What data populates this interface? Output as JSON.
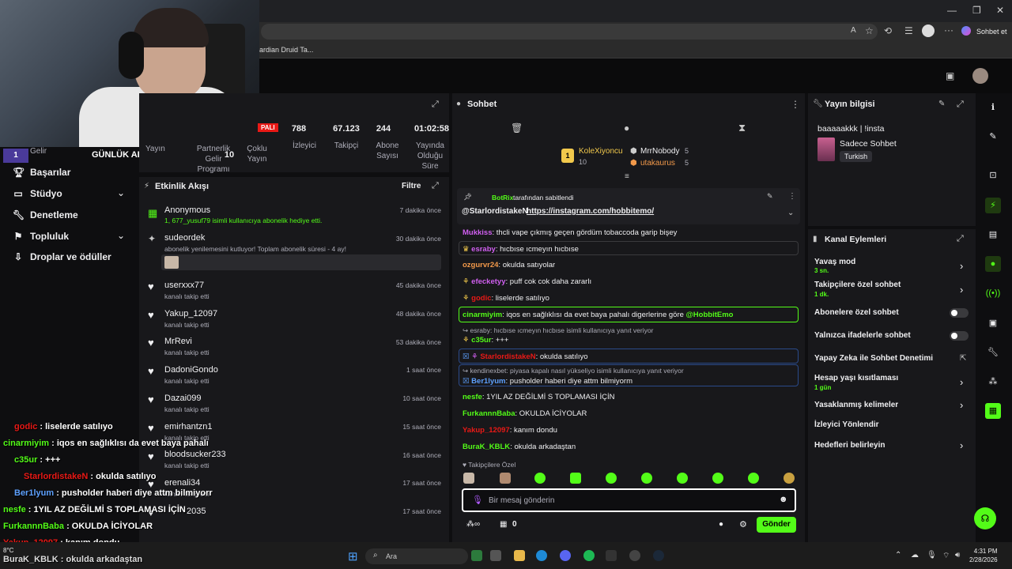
{
  "browser": {
    "bookmark": "ardian Druid Ta...",
    "chat_button": "Sohbet et"
  },
  "sidebar": {
    "header_rank": "1",
    "header_text": "Gelir",
    "daily_sub_label": "GÜNLÜK ABONE",
    "items": [
      {
        "label": "Başarılar",
        "icon": "trophy-icon"
      },
      {
        "label": "Stüdyo",
        "icon": "studio-icon",
        "chevron": true
      },
      {
        "label": "Denetleme",
        "icon": "wrench-icon"
      },
      {
        "label": "Topluluk",
        "icon": "community-icon",
        "chevron": true
      },
      {
        "label": "Droplar ve ödüller",
        "icon": "drops-icon"
      }
    ]
  },
  "stats": {
    "left_labels": [
      "Yayın",
      "Partnerlik Gelir Programı",
      "Çoklu Yayın"
    ],
    "partner_value": "10",
    "badge": "PALI",
    "items": [
      {
        "value": "788",
        "label": "İzleyici"
      },
      {
        "value": "67.123",
        "label": "Takipçi"
      },
      {
        "value": "244",
        "label": "Abone Sayısı"
      },
      {
        "value": "01:02:58",
        "label": "Yayında Olduğu Süre"
      }
    ]
  },
  "feed": {
    "title": "Etkinlik Akışı",
    "filter": "Filtre",
    "rows": [
      {
        "name": "Anonymous",
        "sub": "1, 677_yusuf79 isimli kullanıcıya abonelik hediye etti.",
        "time": "7 dakika önce"
      },
      {
        "name": "sudeordek",
        "sub": "abonelik yenilemesini kutluyor! Toplam abonelik süresi - 4 ay!",
        "time": "30 dakika önce"
      },
      {
        "name": "userxxx77",
        "sub": "kanalı takip etti",
        "time": "45 dakika önce"
      },
      {
        "name": "Yakup_12097",
        "sub": "kanalı takip etti",
        "time": "48 dakika önce"
      },
      {
        "name": "MrRevi",
        "sub": "kanalı takip etti",
        "time": "53 dakika önce"
      },
      {
        "name": "DadoniGondo",
        "sub": "kanalı takip etti",
        "time": "1 saat önce"
      },
      {
        "name": "Dazai099",
        "sub": "kanalı takip etti",
        "time": "10 saat önce"
      },
      {
        "name": "emirhantzn1",
        "sub": "kanalı takip etti",
        "time": "15 saat önce"
      },
      {
        "name": "bloodsucker233",
        "sub": "kanalı takip etti",
        "time": "16 saat önce"
      },
      {
        "name": "erenali34",
        "sub": "kanalı takip etti",
        "time": "17 saat önce"
      },
      {
        "name": "2035",
        "sub": "",
        "time": "17 saat önce"
      }
    ]
  },
  "overlay_chat": [
    {
      "user": "godic",
      "text": "liselerde satılıyo",
      "color": "#e91916"
    },
    {
      "user": "cinarmiyim",
      "text": "iqos en sağlıklısı da evet baya pahalı",
      "color": "#53fc18"
    },
    {
      "user": "c35ur",
      "text": "+++",
      "color": "#53fc18"
    },
    {
      "user": "StarlordistakeN",
      "text": "okulda satılıyo",
      "color": "#e91916"
    },
    {
      "user": "Ber1lyum",
      "text": "pusholder haberi diye attm bilmiyorr",
      "color": "#5ea1ff"
    },
    {
      "user": "nesfe",
      "text": "1YIL AZ DEĞİLMİ S TOPLAMASI İÇİN",
      "color": "#53fc18"
    },
    {
      "user": "FurkannnBaba",
      "text": "OKULDA İCİYOLAR",
      "color": "#53fc18"
    },
    {
      "user": "Yakup_12097",
      "text": "kanım dondu",
      "color": "#e91916"
    },
    {
      "user": "BuraK_KBLK",
      "text": "okulda arkadaştan",
      "color": "#ffffff"
    }
  ],
  "chat": {
    "title": "Sohbet",
    "leaders": [
      {
        "name": "KoleXiyoncu",
        "count": "10",
        "color": "#f2c94c"
      },
      {
        "name": "MrrNobody",
        "count": "5",
        "color": "#efeff1"
      },
      {
        "name": "utakaurus",
        "count": "5",
        "color": "#f2994a"
      }
    ],
    "pinned_by": "BotRix",
    "pinned_label": "tarafından sabitlendi",
    "pinned_text": "@StarlordistakeN",
    "pinned_link": "https://instagram.com/hobbitemo/",
    "messages": [
      {
        "user": "Mukkiss",
        "text": "thcli vape çıkmış geçen gördüm tobaccoda garip bişey",
        "color": "#d05ff0"
      },
      {
        "user": "esraby",
        "text": "hıcbıse ıcmeyın hıcbıse",
        "color": "#d05ff0"
      },
      {
        "user": "ozgurvr24",
        "text": "okulda satıyolar",
        "color": "#f2994a"
      },
      {
        "user": "efecketyy",
        "text": "puff cok cok daha zararlı",
        "color": "#d05ff0"
      },
      {
        "user": "godic",
        "text": "liselerde satılıyo",
        "color": "#e91916"
      },
      {
        "user": "cinarmiyim",
        "text": "iqos en sağlıklısı da evet baya pahalı digerlerine göre",
        "color": "#53fc18",
        "mention": "@HobbitEmo"
      },
      {
        "user": "c35ur",
        "text": "+++",
        "color": "#53fc18",
        "reply": "esraby: hıcbıse ıcmeyın hıcbıse isimli kullanıcıya yanıt veriyor"
      },
      {
        "user": "StarlordistakeN",
        "text": "okulda satılıyo",
        "color": "#e91916"
      },
      {
        "user": "Ber1lyum",
        "text": "pusholder haberi diye attm bilmiyorm",
        "color": "#5ea1ff",
        "reply": "kendinexbet: piyasa kapalı nasıl yükseliyo isimli kullanıcıya yanıt veriyor"
      },
      {
        "user": "nesfe",
        "text": "1YIL AZ DEĞİLMİ S TOPLAMASI İÇİN",
        "color": "#53fc18"
      },
      {
        "user": "FurkannnBaba",
        "text": "OKULDA İCİYOLAR",
        "color": "#53fc18"
      },
      {
        "user": "Yakup_12097",
        "text": "kanım dondu",
        "color": "#e91916"
      },
      {
        "user": "BuraK_KBLK",
        "text": "okulda arkadaştan",
        "color": "#53fc18"
      }
    ],
    "followers_only": "Takipçilere Özel",
    "input_placeholder": "Bir mesaj gönderin",
    "points": "0",
    "send": "Gönder"
  },
  "info": {
    "title": "Yayın bilgisi",
    "stream_title": "baaaaakkk | !insta",
    "category": "Sadece Sohbet",
    "language": "Turkish"
  },
  "actions": {
    "title": "Kanal Eylemleri",
    "items": [
      {
        "label": "Yavaş mod",
        "sub": "3 sn.",
        "control": "chevron"
      },
      {
        "label": "Takipçilere özel sohbet",
        "sub": "1 dk.",
        "control": "chevron"
      },
      {
        "label": "Abonelere özel sohbet",
        "sub": "",
        "control": "toggle"
      },
      {
        "label": "Yalnızca ifadelerle sohbet",
        "sub": "",
        "control": "toggle"
      },
      {
        "label": "Yapay Zeka ile Sohbet Denetimi",
        "sub": "",
        "control": "external"
      },
      {
        "label": "Hesap yaşı kısıtlaması",
        "sub": "1 gün",
        "control": "chevron"
      },
      {
        "label": "Yasaklanmış kelimeler",
        "sub": "",
        "control": "chevron"
      },
      {
        "label": "İzleyici Yönlendir",
        "sub": "",
        "control": "none"
      },
      {
        "label": "Hedefleri belirleyin",
        "sub": "",
        "control": "chevron"
      }
    ]
  },
  "taskbar": {
    "search": "Ara",
    "weather": "8°C",
    "time": "4:31 PM",
    "date": "2/28/2026"
  },
  "colors": {
    "accent": "#53fc18",
    "panel": "#18181b",
    "background": "#0e0e10"
  }
}
